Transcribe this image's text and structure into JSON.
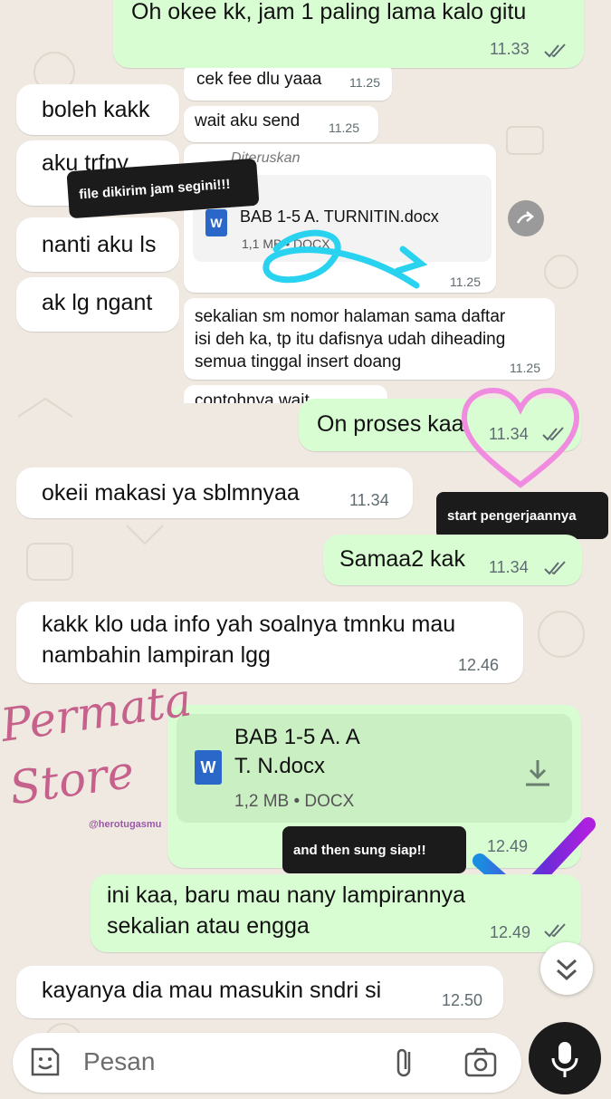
{
  "chat": {
    "m1": {
      "text": "Oh okee kk, jam 1 paling lama kalo gitu",
      "time": "11.33"
    },
    "left_partial": [
      "boleh kakk",
      "aku trfny",
      "nanti aku ls",
      "ak lg ngant"
    ],
    "quoted": {
      "q1": {
        "text": "cek fee dlu yaaa",
        "time": "11.25"
      },
      "q2": {
        "text": "wait aku send",
        "time": "11.25"
      },
      "q3_header": "Diteruskan",
      "q3_file_name": "BAB 1-5 A. TURNITIN.docx",
      "q3_file_info": "1,1 MB • DOCX",
      "q3_time": "11.25",
      "q4": {
        "text": "sekalian sm nomor halaman sama daftar\nisi deh ka, tp itu dafisnya udah diheading\nsemua tinggal insert doang",
        "time": "11.25"
      },
      "q5": {
        "text": "contohnya wait"
      }
    },
    "m2": {
      "text": "On proses kaa",
      "time": "11.34"
    },
    "m3": {
      "text": "okeii makasi ya sblmnyaa",
      "time": "11.34"
    },
    "m4": {
      "text": "Samaa2 kak",
      "time": "11.34"
    },
    "m5": {
      "text": "kakk klo uda info yah soalnya tmnku mau\nnambahin lampiran lgg",
      "time": "12.46"
    },
    "m6": {
      "file_line1": "BAB 1-5 A.    A",
      "file_line2": "T.    N.docx",
      "file_info": "1,2 MB • DOCX",
      "time": "12.49"
    },
    "m7": {
      "text": "ini kaa, baru mau nany lampirannya\nsekalian atau engga",
      "time": "12.49"
    },
    "m8": {
      "text": "kayanya dia mau masukin sndri si",
      "time": "12.50"
    }
  },
  "stickers": {
    "s1": "file dikirim jam segini!!!",
    "s2": "start pengerjaannya",
    "s3": "and then sung siap!!"
  },
  "watermark": {
    "brand": "Permata Store",
    "handle": "@herotugasmu"
  },
  "composer": {
    "placeholder": "Pesan"
  },
  "icons": {
    "word": "W"
  },
  "colors": {
    "incoming": "#ffffff",
    "outgoing": "#d9fdd3",
    "mic_button": "#1b1b1b",
    "highlight_arrow": "#29d3f0",
    "heart": "#f08be0"
  }
}
